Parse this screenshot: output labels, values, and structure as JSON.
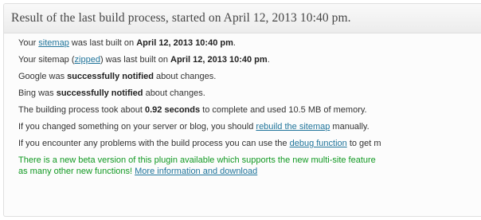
{
  "panel": {
    "title": "Result of the last build process, started on April 12, 2013 10:40 pm."
  },
  "lines": {
    "sitemap": {
      "prefix": "Your ",
      "link": "sitemap",
      "middle": " was last built on ",
      "date": "April 12, 2013 10:40 pm",
      "suffix": "."
    },
    "zipped": {
      "prefix": "Your sitemap (",
      "link": "zipped",
      "middle": ") was last built on ",
      "date": "April 12, 2013 10:40 pm",
      "suffix": "."
    },
    "google": {
      "prefix": "Google was ",
      "bold": "successfully notified",
      "suffix": " about changes."
    },
    "bing": {
      "prefix": "Bing was ",
      "bold": "successfully notified",
      "suffix": " about changes."
    },
    "timing": {
      "prefix": "The building process took about ",
      "bold": "0.92 seconds",
      "suffix": " to complete and used 10.5 MB of memory."
    },
    "rebuild": {
      "prefix": "If you changed something on your server or blog, you should ",
      "link": "rebuild the sitemap",
      "suffix": " manually."
    },
    "debug": {
      "prefix": "If you encounter any problems with the build process you can use the ",
      "link": "debug function",
      "suffix": " to get m"
    },
    "beta": {
      "line1": "There is a new beta version of this plugin available which supports the new multi-site feature",
      "line2_prefix": "as many other new functions! ",
      "link": "More information and download"
    }
  },
  "colors": {
    "link": "#21759b",
    "notice": "#119922",
    "text": "#333333"
  }
}
